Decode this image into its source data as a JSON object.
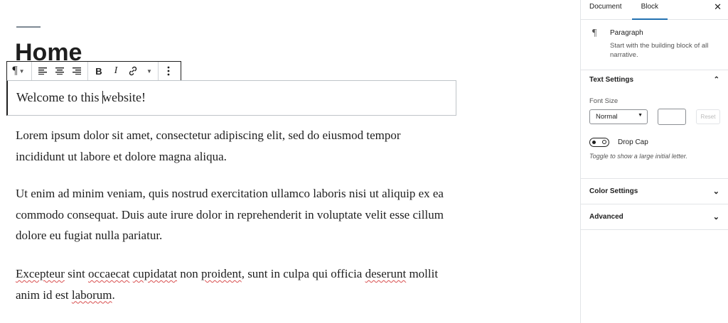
{
  "post": {
    "title": "Home",
    "first_block_before_cursor": "Welcome to this ",
    "first_block_after_cursor": "website!",
    "paragraphs": [
      "Lorem ipsum dolor sit amet, consectetur adipiscing elit, sed do eiusmod tempor incididunt ut labore et dolore magna aliqua.",
      "Ut enim ad minim veniam, quis nostrud exercitation ullamco laboris nisi ut aliquip ex ea commodo consequat. Duis aute irure dolor in reprehenderit in voluptate velit esse cillum dolore eu fugiat nulla pariatur."
    ],
    "last_paragraph": {
      "w1": "Excepteur",
      "t1": " sint ",
      "w2": "occaecat",
      "t2": " ",
      "w3": "cupidatat",
      "t3": " non ",
      "w4": "proident",
      "t4": ", sunt in culpa qui officia ",
      "w5": "deserunt",
      "t5": " mollit anim id est ",
      "w6": "laborum",
      "t6": "."
    }
  },
  "toolbar": {
    "icons": [
      "paragraph-icon",
      "align-left-icon",
      "align-center-icon",
      "align-right-icon",
      "bold-icon",
      "italic-icon",
      "link-icon",
      "more-options-icon"
    ]
  },
  "sidebar": {
    "tabs": [
      {
        "label": "Document",
        "active": false
      },
      {
        "label": "Block",
        "active": true
      }
    ],
    "close_icon": "close-icon",
    "block": {
      "name": "Paragraph",
      "description": "Start with the building block of all narrative."
    },
    "text_settings": {
      "title": "Text Settings",
      "font_size_label": "Font Size",
      "font_size_value": "Normal",
      "reset_label": "Reset",
      "drop_cap_label": "Drop Cap",
      "drop_cap_help": "Toggle to show a large initial letter.",
      "drop_cap_on": false
    },
    "panels": [
      {
        "label": "Color Settings"
      },
      {
        "label": "Advanced"
      }
    ]
  },
  "colors": {
    "accent": "#2271b1",
    "text": "#1e1e1e",
    "spellcheck": "#d94f4f"
  }
}
